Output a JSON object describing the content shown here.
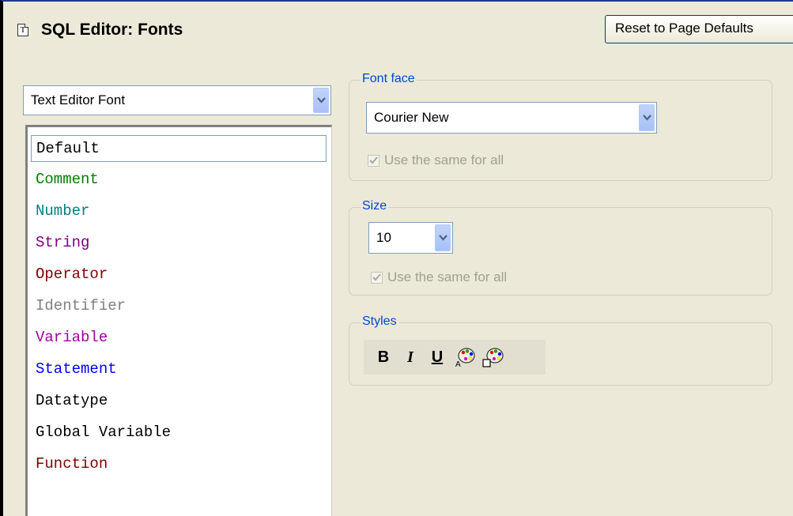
{
  "header": {
    "title": "SQL Editor: Fonts",
    "icon": "page-icon",
    "icon_letter": "T",
    "reset_button": "Reset to Page Defaults"
  },
  "font_category_select": {
    "value": "Text Editor Font"
  },
  "token_list": {
    "items": [
      {
        "label": "Default",
        "color": "#000000",
        "selected": true
      },
      {
        "label": "Comment",
        "color": "#008000"
      },
      {
        "label": "Number",
        "color": "#008080"
      },
      {
        "label": "String",
        "color": "#800080"
      },
      {
        "label": "Operator",
        "color": "#800000"
      },
      {
        "label": "Identifier",
        "color": "#808080"
      },
      {
        "label": "Variable",
        "color": "#a000a0"
      },
      {
        "label": "Statement",
        "color": "#0000ff"
      },
      {
        "label": "Datatype",
        "color": "#000000"
      },
      {
        "label": "Global Variable",
        "color": "#000000"
      },
      {
        "label": "Function",
        "color": "#800000"
      }
    ]
  },
  "font_face": {
    "legend": "Font face",
    "value": "Courier New",
    "same_for_all_label": "Use the same for all",
    "same_for_all_checked": true
  },
  "size": {
    "legend": "Size",
    "value": "10",
    "same_for_all_label": "Use the same for all",
    "same_for_all_checked": true
  },
  "styles": {
    "legend": "Styles",
    "bold_label": "B",
    "italic_label": "I",
    "underline_label": "U",
    "text_color_icon": "text-color-palette-icon",
    "background_color_icon": "background-color-palette-icon",
    "text_color_letter": "A"
  }
}
